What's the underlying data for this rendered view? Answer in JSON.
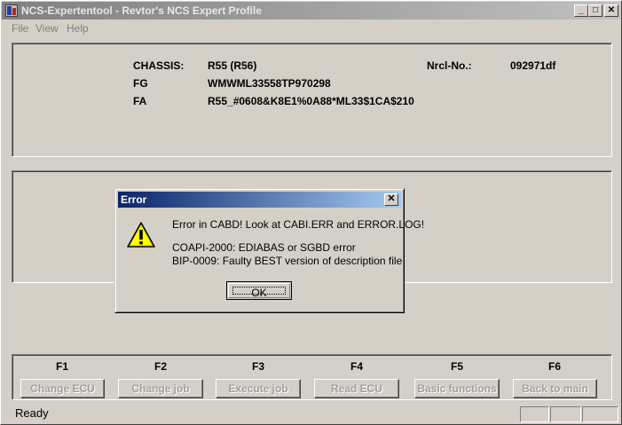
{
  "window": {
    "title": "NCS-Expertentool - Revtor's NCS Expert Profile",
    "minimize": "_",
    "maximize": "□",
    "close": "✕"
  },
  "menu": {
    "items": [
      "File",
      "View",
      "Help"
    ]
  },
  "info": {
    "chassis_label": "CHASSIS:",
    "chassis_value": "R55 (R56)",
    "nrcl_label": "Nrcl-No.:",
    "nrcl_value": "092971df",
    "fg_label": "FG",
    "fg_value": "WMWML33558TP970298",
    "fa_label": "FA",
    "fa_value": "R55_#0608&K8E1%0A88*ML33$1CA$210"
  },
  "function_keys": [
    {
      "key": "F1",
      "label": "Change ECU"
    },
    {
      "key": "F2",
      "label": "Change job"
    },
    {
      "key": "F3",
      "label": "Execute job"
    },
    {
      "key": "F4",
      "label": "Read ECU"
    },
    {
      "key": "F5",
      "label": "Basic functions"
    },
    {
      "key": "F6",
      "label": "Back to main"
    }
  ],
  "status": {
    "text": "Ready"
  },
  "dialog": {
    "title": "Error",
    "close": "✕",
    "message": "Error in CABD! Look at CABI.ERR and ERROR.LOG!",
    "detail_1": "COAPI-2000: EDIABAS or SGBD error",
    "detail_2": "BIP-0009: Faulty BEST version of description file",
    "ok_label": "OK",
    "icon": "warning-icon"
  }
}
